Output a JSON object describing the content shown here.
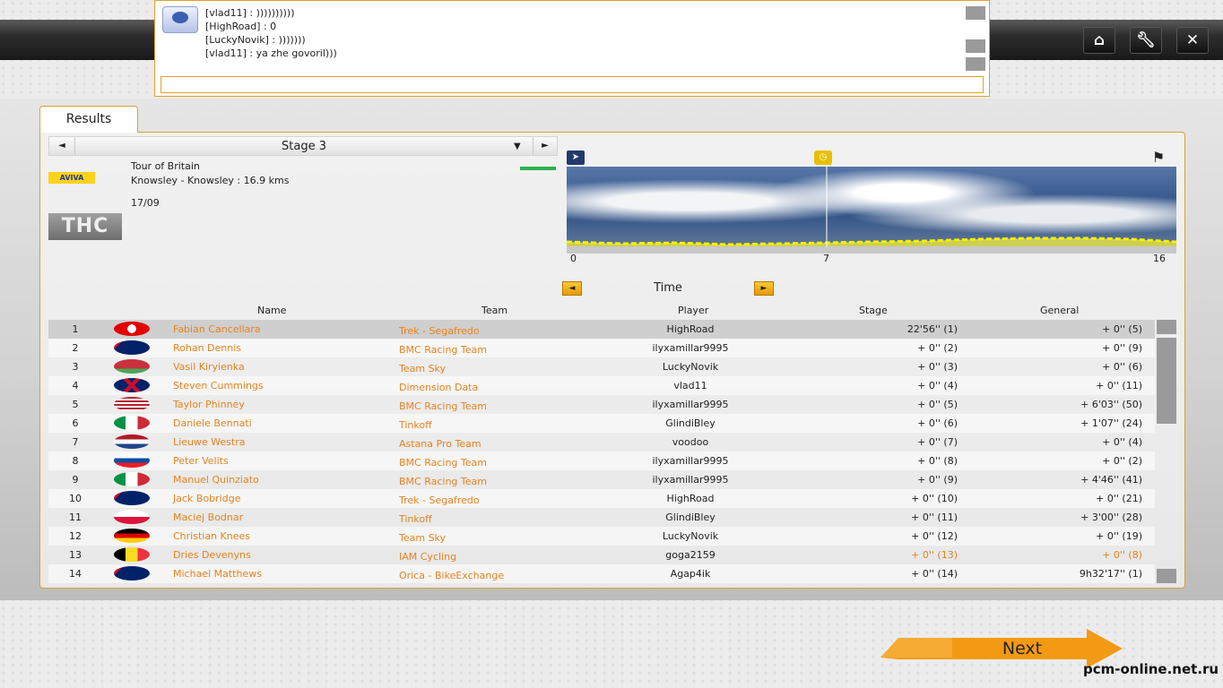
{
  "chat": {
    "lines": [
      "[vlad11] : ))))))))))",
      "[HighRoad] : 0",
      "[LuckyNovik] : )))))))",
      "[vlad11] : ya zhe govoril)))"
    ],
    "input_value": ""
  },
  "tab": {
    "label": "Results"
  },
  "stage": {
    "prev": "◄",
    "label": "Stage 3",
    "dropdown": "▼",
    "next": "►",
    "sponsor": "AVIVA",
    "badge": "THC",
    "race": "Tour of Britain",
    "route": "Knowsley - Knowsley : 16.9 kms",
    "date": "17/09"
  },
  "profile": {
    "km_start": "0",
    "km_mid": "7",
    "km_end": "16",
    "start_icon": "sprint-icon",
    "checkpoint_icon": "clock-icon",
    "finish_icon": "checkered-flag-icon"
  },
  "sort": {
    "left": "◄",
    "label": "Time",
    "right": "►"
  },
  "columns": {
    "name": "Name",
    "team": "Team",
    "player": "Player",
    "stage": "Stage",
    "general": "General"
  },
  "rows": [
    {
      "rank": "1",
      "flag": "switzerland",
      "name": "Fabian Cancellara",
      "team": "Trek - Segafredo",
      "player": "HighRoad",
      "stage": "22'56'' (1)",
      "general": "+ 0'' (5)"
    },
    {
      "rank": "2",
      "flag": "australia",
      "name": "Rohan Dennis",
      "team": "BMC Racing Team",
      "player": "ilyxamillar9995",
      "stage": "+ 0'' (2)",
      "general": "+ 0'' (9)"
    },
    {
      "rank": "3",
      "flag": "belarus",
      "name": "Vasil Kiryienka",
      "team": "Team Sky",
      "player": "LuckyNovik",
      "stage": "+ 0'' (3)",
      "general": "+ 0'' (6)"
    },
    {
      "rank": "4",
      "flag": "united-kingdom",
      "name": "Steven Cummings",
      "team": "Dimension Data",
      "player": "vlad11",
      "stage": "+ 0'' (4)",
      "general": "+ 0'' (11)"
    },
    {
      "rank": "5",
      "flag": "usa",
      "name": "Taylor Phinney",
      "team": "BMC Racing Team",
      "player": "ilyxamillar9995",
      "stage": "+ 0'' (5)",
      "general": "+ 6'03'' (50)"
    },
    {
      "rank": "6",
      "flag": "italy",
      "name": "Daniele Bennati",
      "team": "Tinkoff",
      "player": "GlindiBley",
      "stage": "+ 0'' (6)",
      "general": "+ 1'07'' (24)"
    },
    {
      "rank": "7",
      "flag": "netherlands",
      "name": "Lieuwe Westra",
      "team": "Astana Pro Team",
      "player": "voodoo",
      "stage": "+ 0'' (7)",
      "general": "+ 0'' (4)"
    },
    {
      "rank": "8",
      "flag": "slovakia",
      "name": "Peter Velits",
      "team": "BMC Racing Team",
      "player": "ilyxamillar9995",
      "stage": "+ 0'' (8)",
      "general": "+ 0'' (2)"
    },
    {
      "rank": "9",
      "flag": "italy",
      "name": "Manuel Quinziato",
      "team": "BMC Racing Team",
      "player": "ilyxamillar9995",
      "stage": "+ 0'' (9)",
      "general": "+ 4'46'' (41)"
    },
    {
      "rank": "10",
      "flag": "australia",
      "name": "Jack Bobridge",
      "team": "Trek - Segafredo",
      "player": "HighRoad",
      "stage": "+ 0'' (10)",
      "general": "+ 0'' (21)"
    },
    {
      "rank": "11",
      "flag": "poland",
      "name": "Maciej Bodnar",
      "team": "Tinkoff",
      "player": "GlindiBley",
      "stage": "+ 0'' (11)",
      "general": "+ 3'00'' (28)"
    },
    {
      "rank": "12",
      "flag": "germany",
      "name": "Christian Knees",
      "team": "Team Sky",
      "player": "LuckyNovik",
      "stage": "+ 0'' (12)",
      "general": "+ 0'' (19)"
    },
    {
      "rank": "13",
      "flag": "belgium",
      "name": "Dries Devenyns",
      "team": "IAM Cycling",
      "player": "goga2159",
      "stage": "+ 0'' (13)",
      "general": "+ 0'' (8)"
    },
    {
      "rank": "14",
      "flag": "australia",
      "name": "Michael Matthews",
      "team": "Orica - BikeExchange",
      "player": "Agap4ik",
      "stage": "+ 0'' (14)",
      "general": "9h32'17'' (1)"
    }
  ],
  "buttons": {
    "home": "home-icon",
    "settings": "wrench-icon",
    "close": "close-icon",
    "next": "Next"
  },
  "watermark": "pcm-online.net.ru",
  "colors": {
    "accent": "#e8821e",
    "border": "#e0a030",
    "highlight": "#cfcfcf"
  }
}
